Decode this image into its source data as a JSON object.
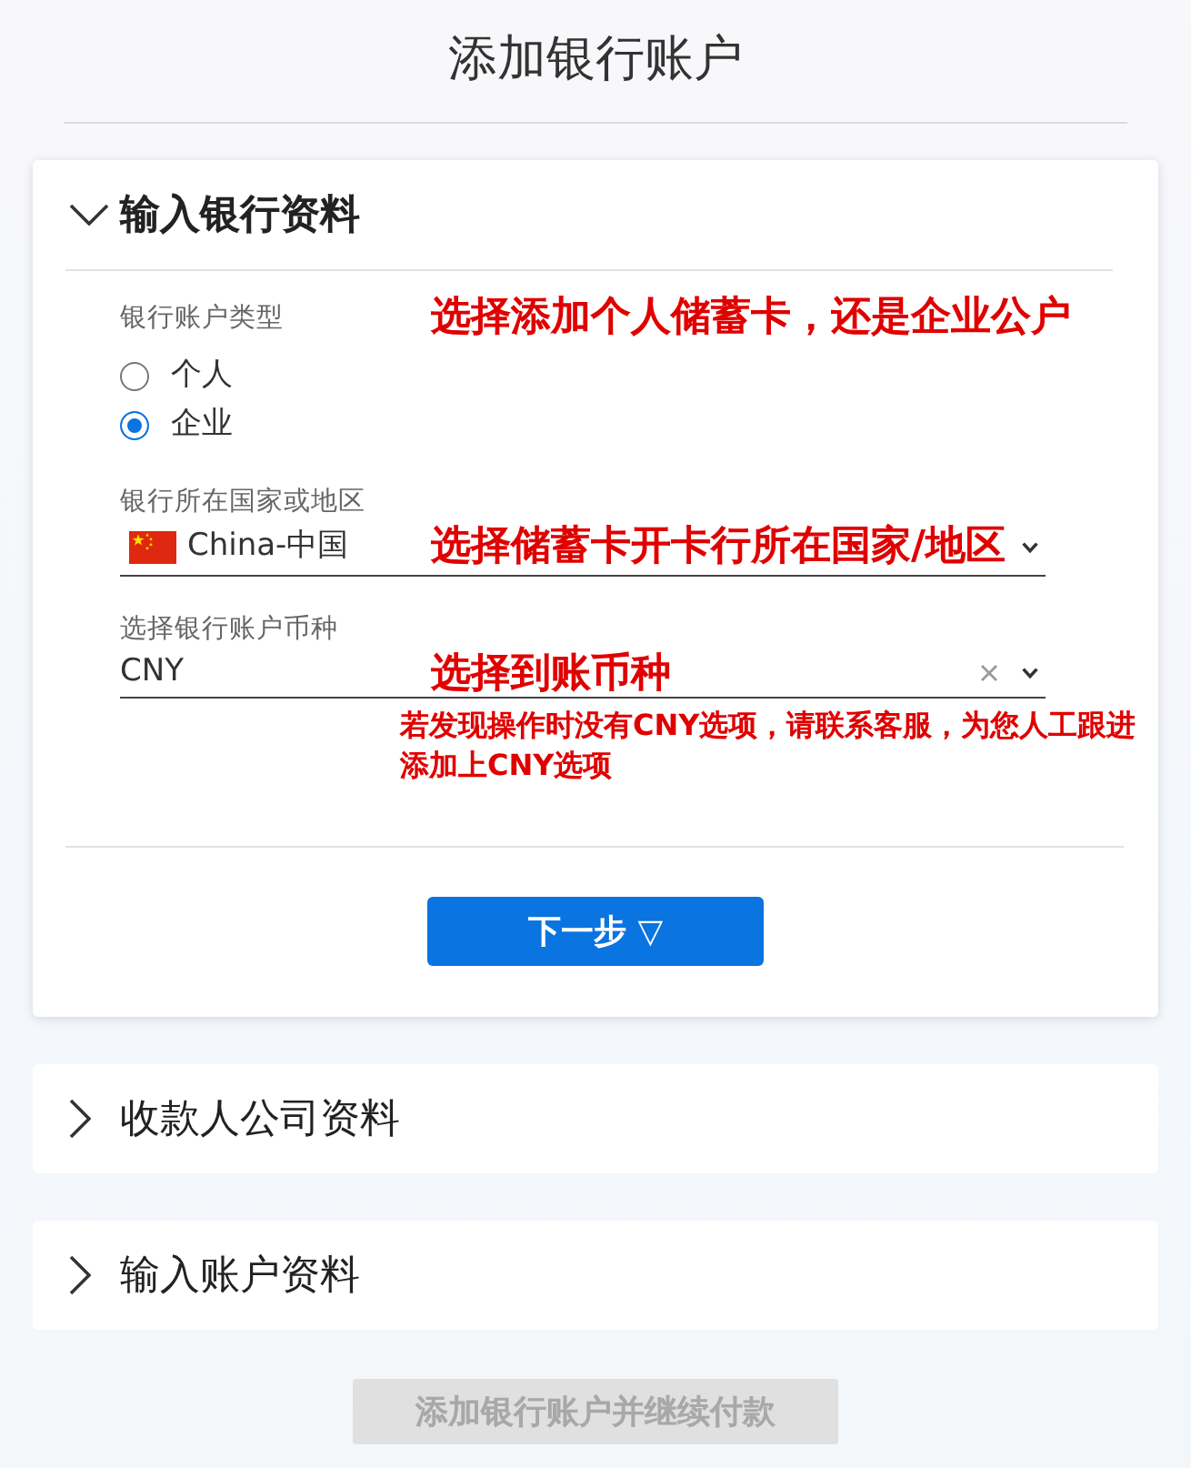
{
  "page_title": "添加银行账户",
  "sections": [
    {
      "title": "输入银行资料",
      "expanded": true,
      "fields": [
        {
          "kind": "radio",
          "label": "银行账户类型",
          "options": [
            {
              "label": "个人",
              "selected": false
            },
            {
              "label": "企业",
              "selected": true
            }
          ],
          "annotation": "选择添加个人储蓄卡，还是企业公户"
        },
        {
          "kind": "country_select",
          "label": "银行所在国家或地区",
          "value": "China-中国",
          "annotation": "选择储蓄卡开卡行所在国家/地区"
        },
        {
          "kind": "select",
          "label": "选择银行账户币种",
          "value": "CNY",
          "clearable": true,
          "annotation": "选择到账币种",
          "note": "若发现操作时没有CNY选项，请联系客服，为您人工跟进添加上CNY选项"
        }
      ],
      "next_button": {
        "label": "下一步 ▽"
      }
    },
    {
      "title": "收款人公司资料",
      "expanded": false
    },
    {
      "title": "输入账户资料",
      "expanded": false
    }
  ],
  "submit_button": {
    "label": "添加银行账户并继续付款",
    "disabled": true
  }
}
